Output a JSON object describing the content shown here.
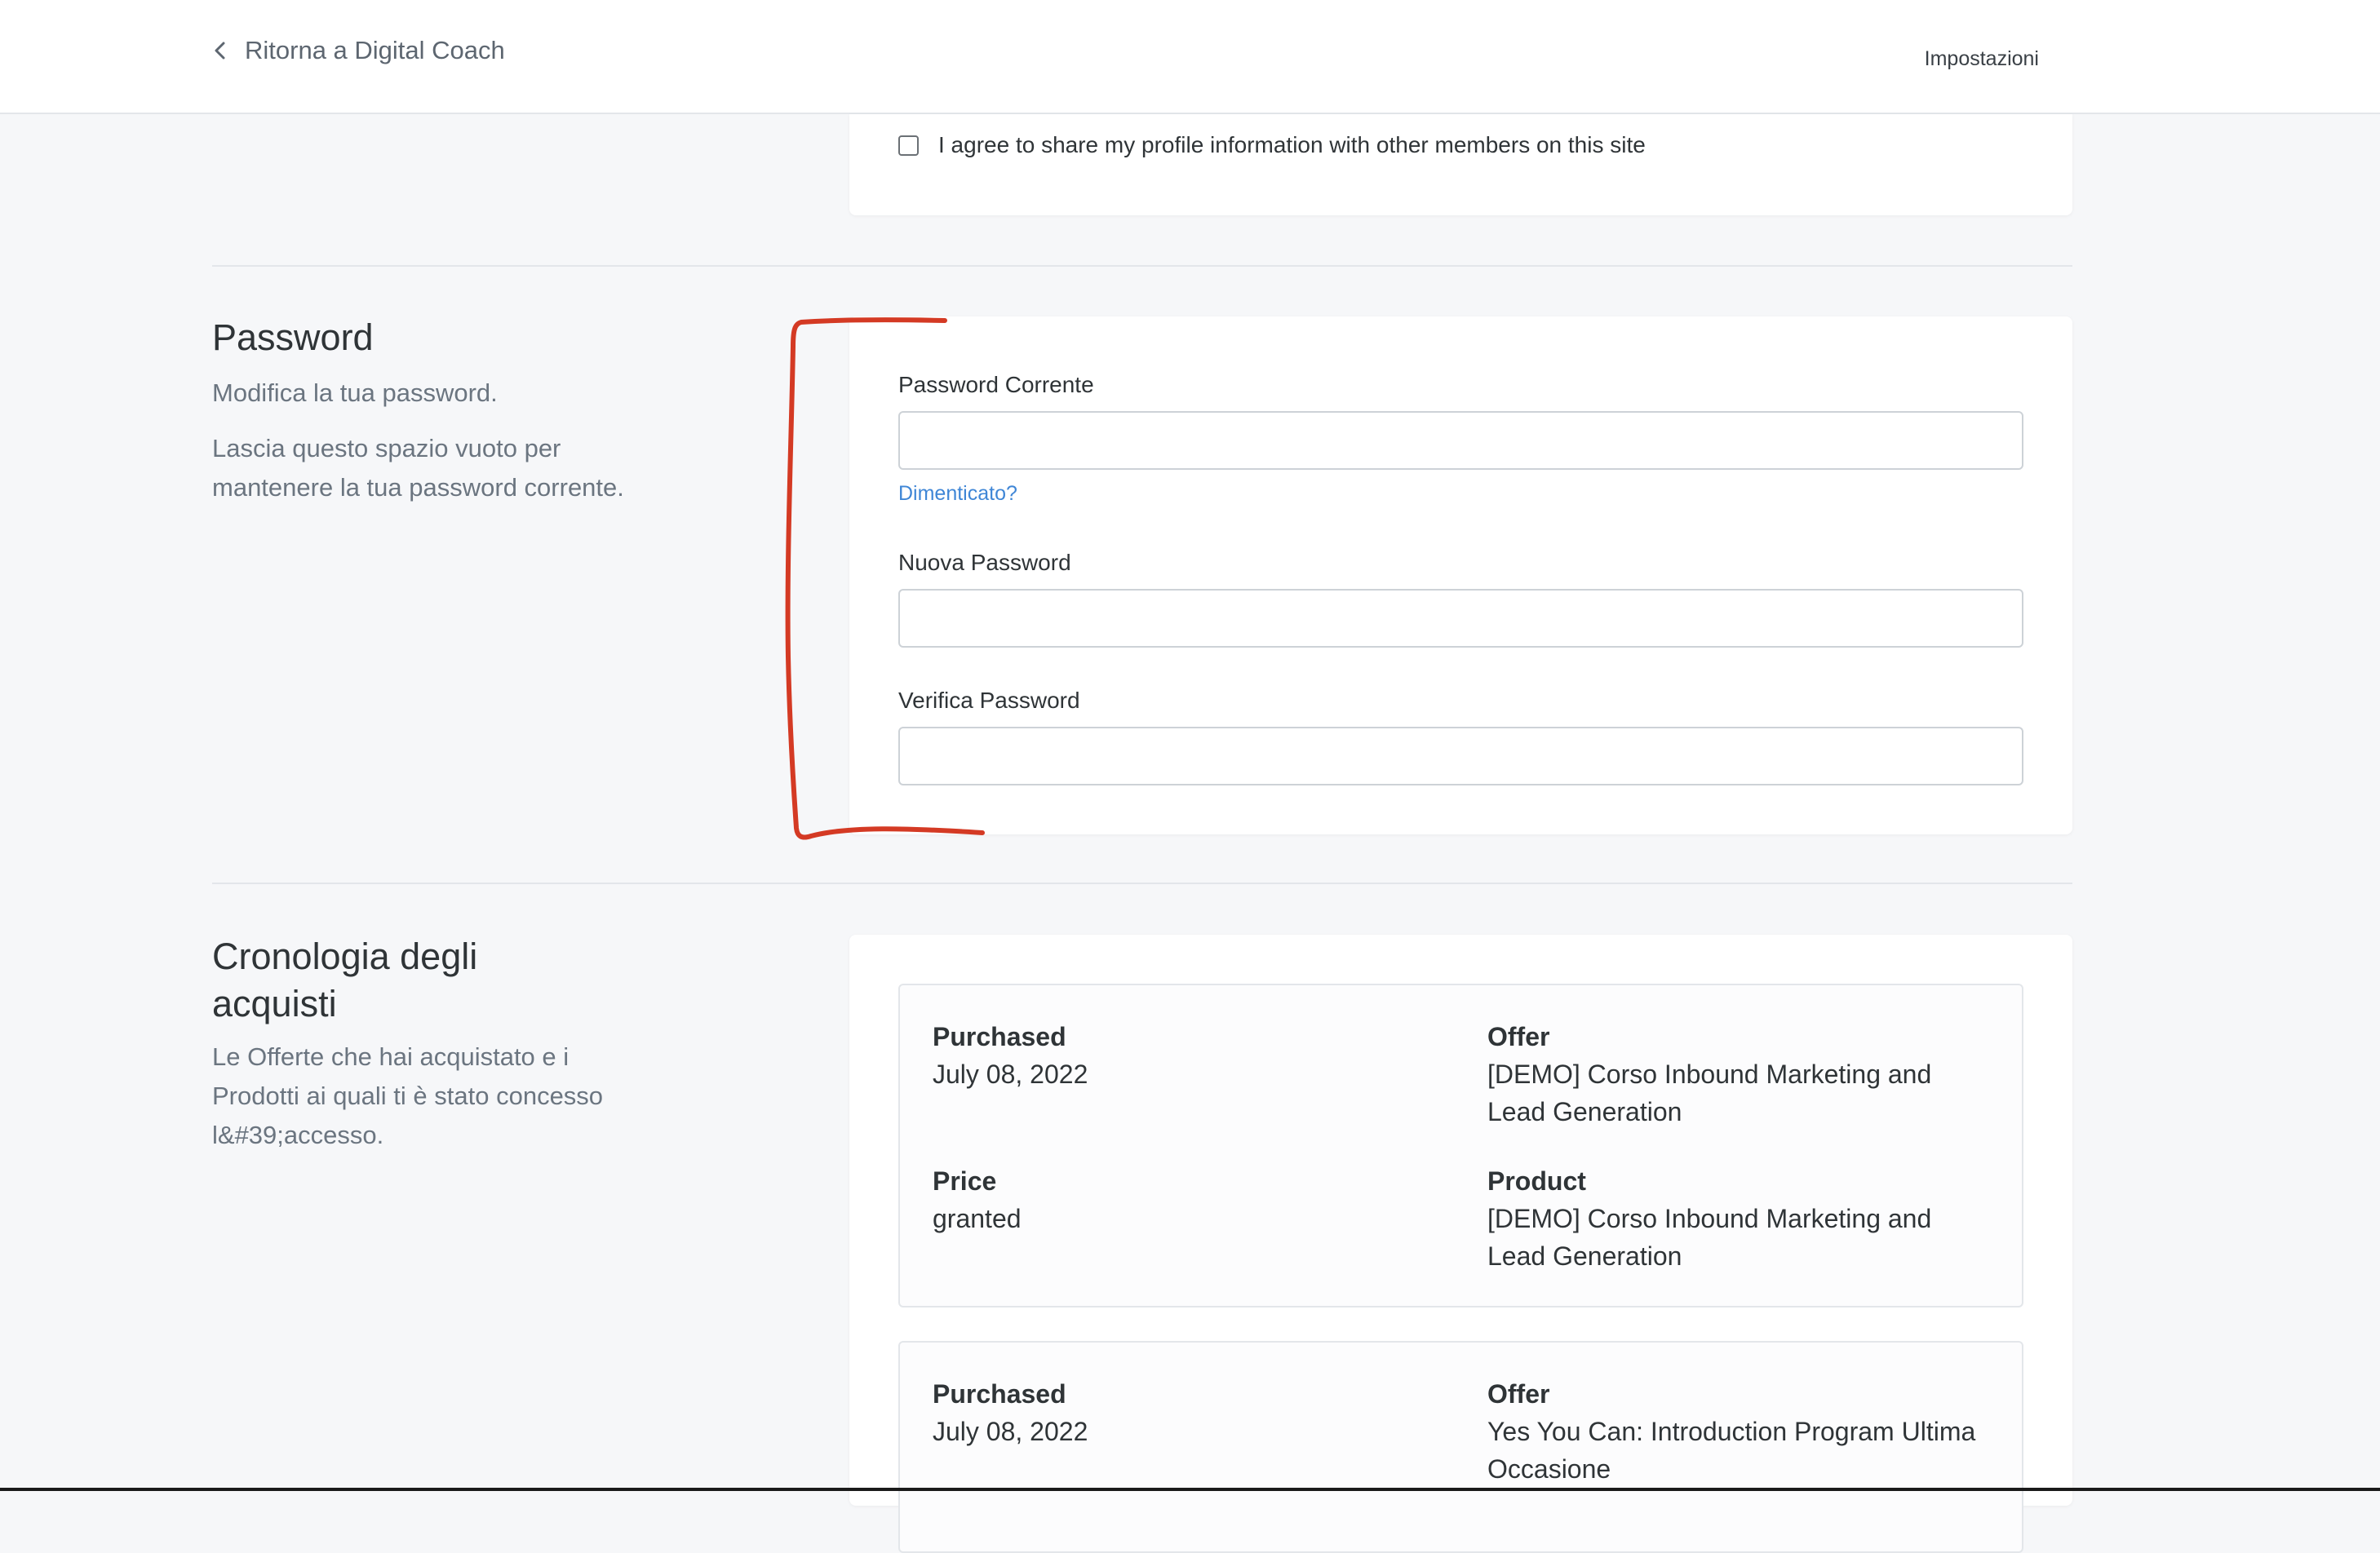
{
  "header": {
    "back_label": "Ritorna a Digital Coach",
    "settings_label": "Impostazioni"
  },
  "consent": {
    "checkbox_checked": false,
    "label": "I agree to share my profile information with other members on this site"
  },
  "password_section": {
    "title": "Password",
    "description": "Modifica la tua password.",
    "note": "Lascia questo spazio vuoto per mantenere la tua password corrente.",
    "current_label": "Password Corrente",
    "current_value": "",
    "forgot_label": "Dimenticato?",
    "new_label": "Nuova Password",
    "new_value": "",
    "verify_label": "Verifica Password",
    "verify_value": ""
  },
  "history_section": {
    "title": "Cronologia degli acquisti",
    "description": "Le Offerte che hai acquistato e i Prodotti ai quali ti è stato concesso l&#39;accesso.",
    "purchases": [
      {
        "purchased_label": "Purchased",
        "purchased_value": "July 08, 2022",
        "offer_label": "Offer",
        "offer_value": "[DEMO] Corso Inbound Marketing and Lead Generation",
        "price_label": "Price",
        "price_value": "granted",
        "product_label": "Product",
        "product_value": "[DEMO] Corso Inbound Marketing and Lead Generation"
      },
      {
        "purchased_label": "Purchased",
        "purchased_value": "July 08, 2022",
        "offer_label": "Offer",
        "offer_value": "Yes You Can: Introduction Program Ultima Occasione"
      }
    ]
  },
  "colors": {
    "annotation": "#d43a24",
    "link": "#3f86d6",
    "background": "#f6f7f9"
  },
  "icons": {
    "back": "chevron-left-icon"
  }
}
